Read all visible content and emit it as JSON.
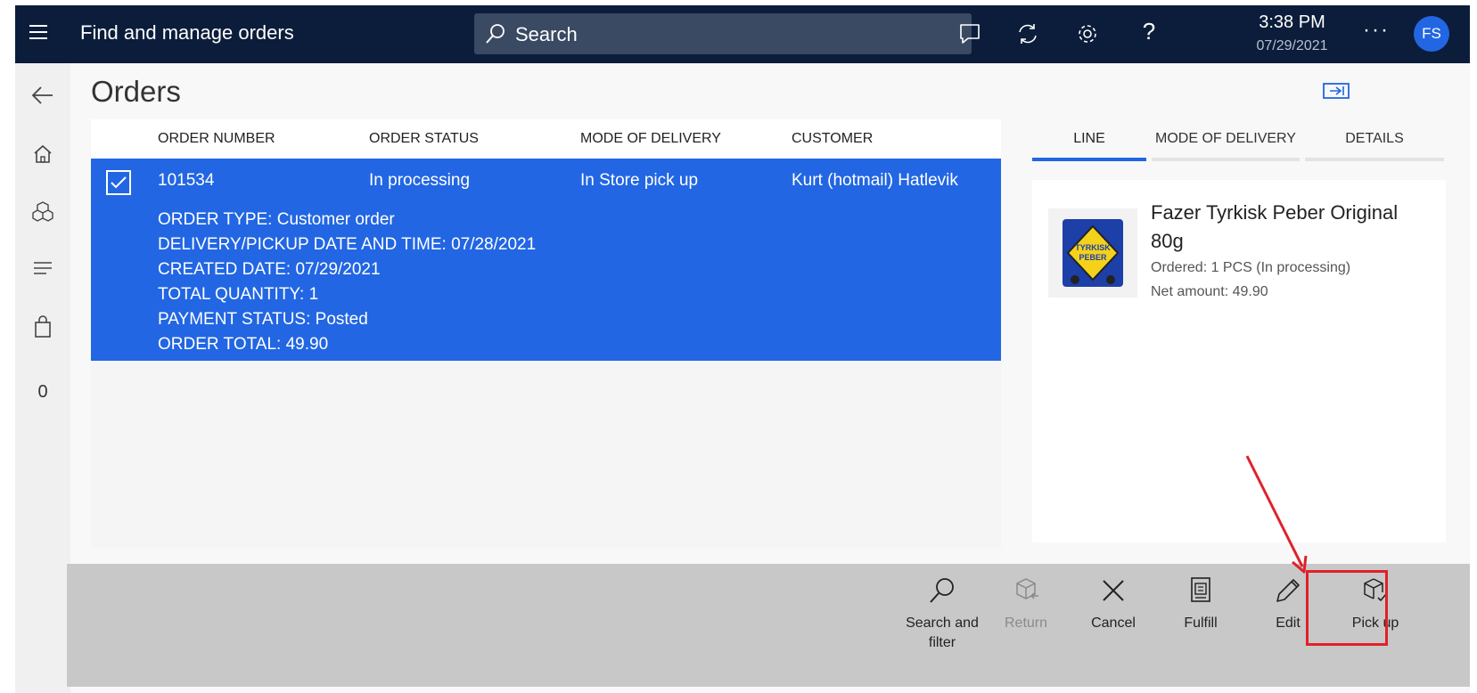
{
  "header": {
    "menu_icon": "hamburger-icon",
    "title": "Find and manage orders",
    "search_placeholder": "Search",
    "icons": [
      "feedback-icon",
      "refresh-icon",
      "settings-icon",
      "help-icon"
    ],
    "time": "3:38 PM",
    "date": "07/29/2021",
    "more": "···",
    "avatar_initials": "FS"
  },
  "leftnav": {
    "items": [
      "back-arrow-icon",
      "home-icon",
      "products-icon",
      "lines-icon",
      "shopping-bag-icon"
    ],
    "count": "0"
  },
  "page": {
    "title": "Orders"
  },
  "grid": {
    "columns": [
      "ORDER NUMBER",
      "ORDER STATUS",
      "MODE OF DELIVERY",
      "CUSTOMER"
    ],
    "rows": [
      {
        "order_number": "101534",
        "order_status": "In processing",
        "mode_of_delivery": "In Store pick up",
        "customer": "Kurt (hotmail) Hatlevik",
        "details": [
          "ORDER TYPE: Customer order",
          "DELIVERY/PICKUP DATE AND TIME: 07/28/2021",
          "CREATED DATE: 07/29/2021",
          "TOTAL QUANTITY: 1",
          "PAYMENT STATUS: Posted",
          "ORDER TOTAL: 49.90"
        ]
      }
    ]
  },
  "right_panel": {
    "tabs": [
      "LINE",
      "MODE OF DELIVERY",
      "DETAILS"
    ],
    "active_tab": "LINE",
    "line": {
      "product_name": "Fazer Tyrkisk Peber Original 80g",
      "ordered": "Ordered: 1 PCS (In processing)",
      "net_amount": "Net amount: 49.90",
      "image_text": [
        "TYRKISK",
        "PEBER"
      ]
    }
  },
  "commands": {
    "search_filter": "Search and filter",
    "return": "Return",
    "cancel": "Cancel",
    "fulfill": "Fulfill",
    "edit": "Edit",
    "pick_up": "Pick up"
  },
  "colors": {
    "topbar": "#0b1d3a",
    "accent": "#2266e3",
    "highlight": "#e0202a",
    "cmdbar": "#c8c8c8"
  }
}
